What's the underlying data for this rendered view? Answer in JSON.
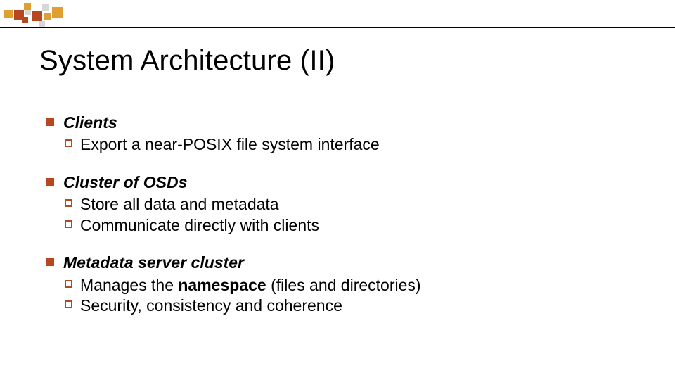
{
  "title": "System Architecture (II)",
  "groups": [
    {
      "heading": "Clients",
      "items": [
        {
          "text": "Export a near-POSIX file system interface"
        }
      ]
    },
    {
      "heading": "Cluster of OSDs",
      "items": [
        {
          "text": "Store all data and metadata"
        },
        {
          "text": "Communicate directly with clients"
        }
      ]
    },
    {
      "heading": "Metadata server cluster",
      "items": [
        {
          "pre": "Manages the ",
          "bold": "namespace",
          "post": " (files and directories)"
        },
        {
          "text": "Security, consistency and coherence"
        }
      ]
    }
  ],
  "colors": {
    "accent": "#b64721",
    "gold": "#e0a030"
  }
}
